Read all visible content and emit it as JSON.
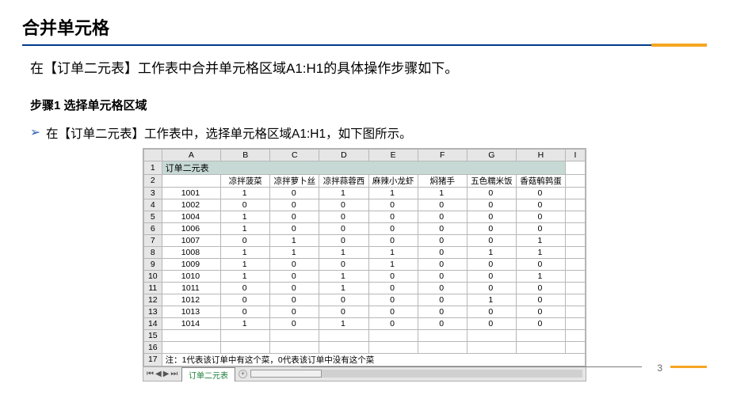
{
  "title": "合并单元格",
  "intro": "在【订单二元表】工作表中合并单元格区域A1:H1的具体操作步骤如下。",
  "step_title": "步骤1 选择单元格区域",
  "bullet": "在【订单二元表】工作表中，选择单元格区域A1:H1，如下图所示。",
  "page_num": "3",
  "excel": {
    "col_headers": [
      "A",
      "B",
      "C",
      "D",
      "E",
      "F",
      "G",
      "H",
      "I"
    ],
    "row1_title": "订单二元表",
    "row2_headers": [
      "",
      "凉拌菠菜",
      "凉拌萝卜丝",
      "凉拌蒜蓉西",
      "麻辣小龙虾",
      "焖猪手",
      "五色糯米饭",
      "香菇鹌鹑蛋",
      ""
    ],
    "data_rows": [
      [
        "1001",
        "1",
        "0",
        "1",
        "1",
        "1",
        "0",
        "0",
        ""
      ],
      [
        "1002",
        "0",
        "0",
        "0",
        "0",
        "0",
        "0",
        "0",
        ""
      ],
      [
        "1004",
        "1",
        "0",
        "0",
        "0",
        "0",
        "0",
        "0",
        ""
      ],
      [
        "1006",
        "1",
        "0",
        "0",
        "0",
        "0",
        "0",
        "0",
        ""
      ],
      [
        "1007",
        "0",
        "1",
        "0",
        "0",
        "0",
        "0",
        "1",
        ""
      ],
      [
        "1008",
        "1",
        "1",
        "1",
        "1",
        "0",
        "1",
        "1",
        ""
      ],
      [
        "1009",
        "1",
        "0",
        "0",
        "1",
        "0",
        "0",
        "0",
        ""
      ],
      [
        "1010",
        "1",
        "0",
        "1",
        "0",
        "0",
        "0",
        "1",
        ""
      ],
      [
        "1011",
        "0",
        "0",
        "1",
        "0",
        "0",
        "0",
        "0",
        ""
      ],
      [
        "1012",
        "0",
        "0",
        "0",
        "0",
        "0",
        "1",
        "0",
        ""
      ],
      [
        "1013",
        "0",
        "0",
        "0",
        "0",
        "0",
        "0",
        "0",
        ""
      ],
      [
        "1014",
        "1",
        "0",
        "1",
        "0",
        "0",
        "0",
        "0",
        ""
      ]
    ],
    "empty_rows": [
      "15",
      "16"
    ],
    "note": "注：1代表该订单中有这个菜，0代表该订单中没有这个菜",
    "sheet_tab": "订单二元表"
  }
}
